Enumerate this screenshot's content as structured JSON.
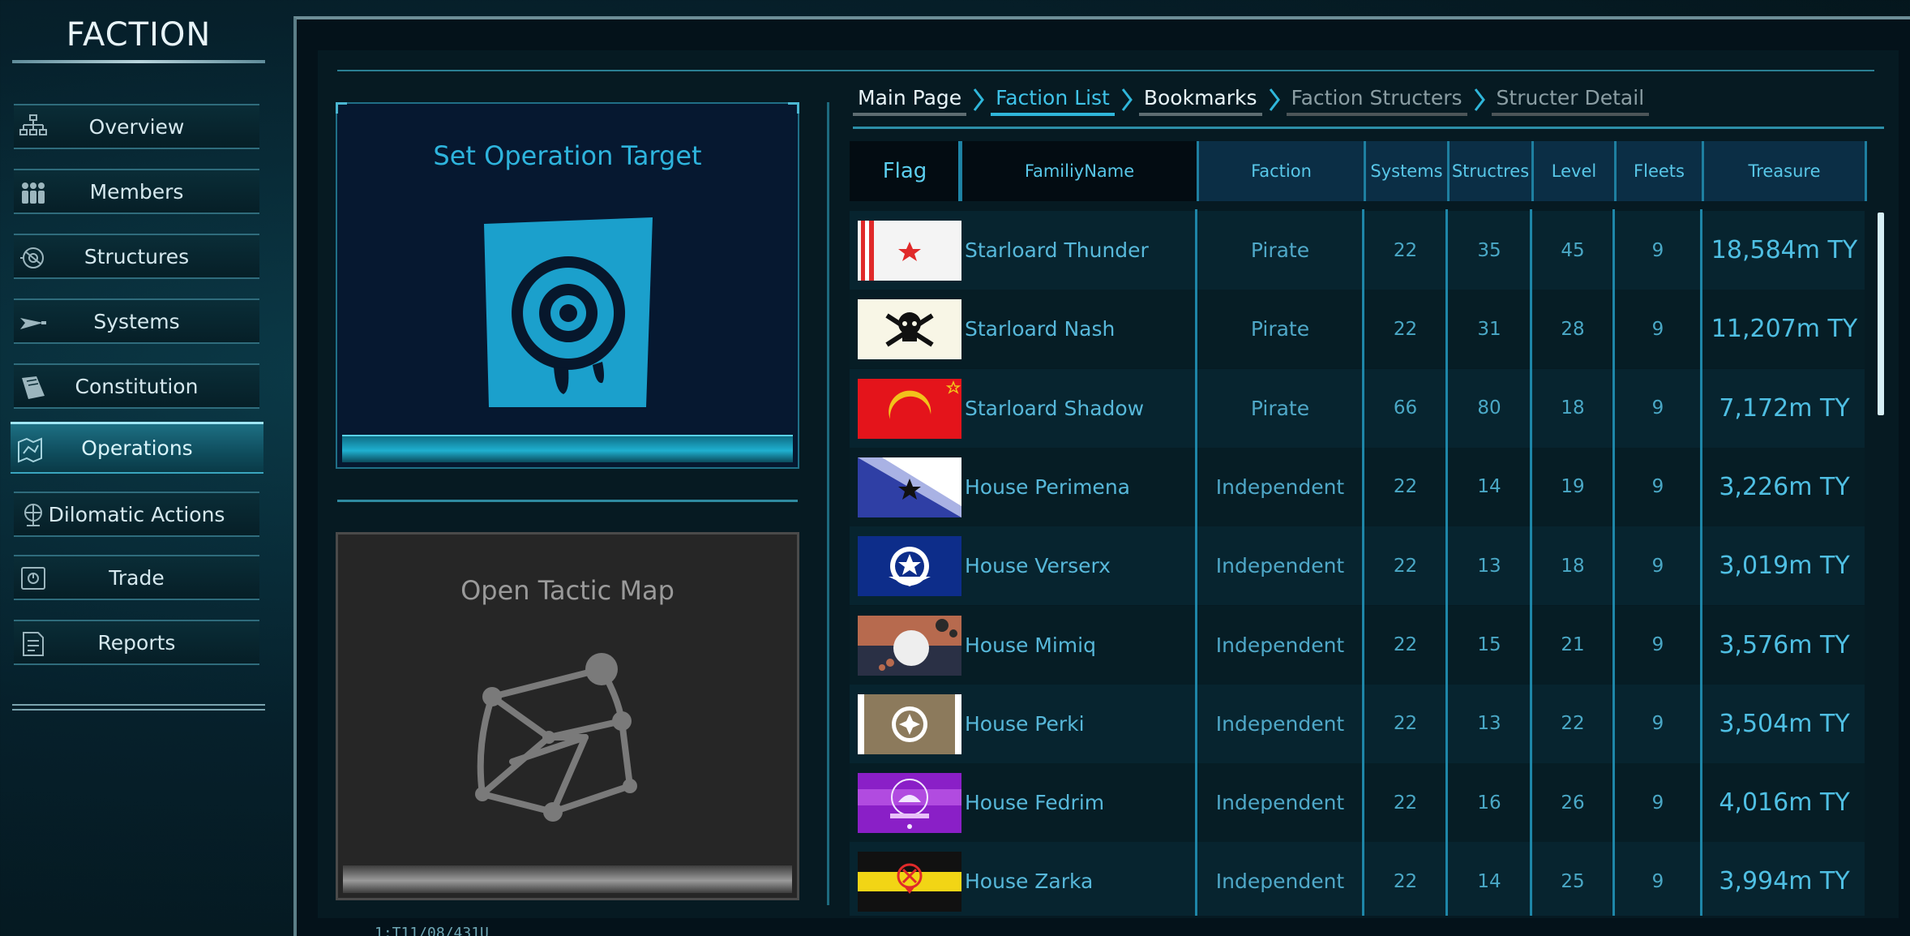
{
  "sidebar": {
    "title": "FACTION",
    "items": [
      {
        "label": "Overview",
        "icon": "hierarchy-icon",
        "active": false
      },
      {
        "label": "Members",
        "icon": "people-icon",
        "active": false
      },
      {
        "label": "Structures",
        "icon": "station-icon",
        "active": false
      },
      {
        "label": "Systems",
        "icon": "ship-icon",
        "active": false
      },
      {
        "label": "Constitution",
        "icon": "book-icon",
        "active": false
      },
      {
        "label": "Operations",
        "icon": "map-icon",
        "active": true
      },
      {
        "label": "Dilomatic Actions",
        "icon": "globe-icon",
        "active": false
      },
      {
        "label": "Trade",
        "icon": "safe-icon",
        "active": false
      },
      {
        "label": "Reports",
        "icon": "document-icon",
        "active": false
      }
    ]
  },
  "operations": {
    "target_title": "Set Operation Target",
    "tactic_title": "Open Tactic Map"
  },
  "breadcrumb": [
    {
      "label": "Main Page",
      "state": "normal"
    },
    {
      "label": "Faction List",
      "state": "active"
    },
    {
      "label": "Bookmarks",
      "state": "normal"
    },
    {
      "label": "Faction Structers",
      "state": "disabled"
    },
    {
      "label": "Structer Detail",
      "state": "disabled"
    }
  ],
  "table": {
    "headers": {
      "flag": "Flag",
      "name": "FamiliyName",
      "faction": "Faction",
      "systems": "Systems",
      "structures": "Structres",
      "level": "Level",
      "fleets": "Fleets",
      "treasure": "Treasure"
    },
    "rows": [
      {
        "flag": "starloard-thunder-flag",
        "name": "Starloard Thunder",
        "faction": "Pirate",
        "systems": "22",
        "structures": "35",
        "level": "45",
        "fleets": "9",
        "treasure": "18,584m TY"
      },
      {
        "flag": "starloard-nash-flag",
        "name": "Starloard Nash",
        "faction": "Pirate",
        "systems": "22",
        "structures": "31",
        "level": "28",
        "fleets": "9",
        "treasure": "11,207m TY"
      },
      {
        "flag": "starloard-shadow-flag",
        "name": "Starloard Shadow",
        "faction": "Pirate",
        "systems": "66",
        "structures": "80",
        "level": "18",
        "fleets": "9",
        "treasure": "7,172m TY"
      },
      {
        "flag": "house-perimena-flag",
        "name": "House Perimena",
        "faction": "Independent",
        "systems": "22",
        "structures": "14",
        "level": "19",
        "fleets": "9",
        "treasure": "3,226m TY"
      },
      {
        "flag": "house-verserx-flag",
        "name": "House Verserx",
        "faction": "Independent",
        "systems": "22",
        "structures": "13",
        "level": "18",
        "fleets": "9",
        "treasure": "3,019m TY"
      },
      {
        "flag": "house-mimiq-flag",
        "name": "House Mimiq",
        "faction": "Independent",
        "systems": "22",
        "structures": "15",
        "level": "21",
        "fleets": "9",
        "treasure": "3,576m TY"
      },
      {
        "flag": "house-perki-flag",
        "name": "House Perki",
        "faction": "Independent",
        "systems": "22",
        "structures": "13",
        "level": "22",
        "fleets": "9",
        "treasure": "3,504m TY"
      },
      {
        "flag": "house-fedrim-flag",
        "name": "House Fedrim",
        "faction": "Independent",
        "systems": "22",
        "structures": "16",
        "level": "26",
        "fleets": "9",
        "treasure": "4,016m TY"
      },
      {
        "flag": "house-zarka-flag",
        "name": "House Zarka",
        "faction": "Independent",
        "systems": "22",
        "structures": "14",
        "level": "25",
        "fleets": "9",
        "treasure": "3,994m TY"
      }
    ]
  },
  "colors": {
    "accent": "#2eb4dd",
    "active_tab": "#1d6f83",
    "panel_bg": "#061a22"
  },
  "status": {
    "date": "1:T11/08/431U"
  }
}
